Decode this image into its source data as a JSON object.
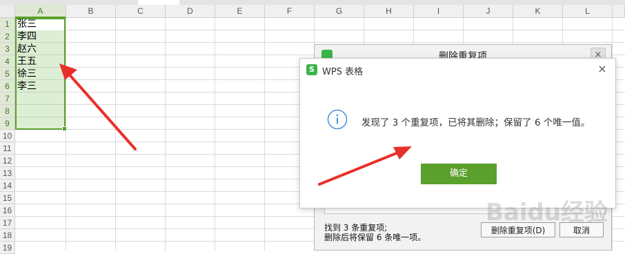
{
  "columns": [
    "A",
    "B",
    "C",
    "D",
    "E",
    "F",
    "G",
    "H",
    "I",
    "J",
    "K",
    "L"
  ],
  "rows": [
    "1",
    "2",
    "3",
    "4",
    "5",
    "6",
    "7",
    "8",
    "9",
    "10",
    "11",
    "12",
    "13",
    "14",
    "15",
    "16",
    "17",
    "18",
    "19"
  ],
  "cells": [
    "张三",
    "李四",
    "赵六",
    "王五",
    "徐三",
    "李三"
  ],
  "background_dialog": {
    "title": "删除重复项",
    "close": "×",
    "found_text": "找到 3 条重复项;",
    "keep_text": "删除后将保留 6 条唯一项。",
    "delete_button": "删除重复项(D)",
    "cancel_button": "取消"
  },
  "dialog": {
    "logo": "S",
    "title": "WPS 表格",
    "close": "×",
    "message": "发现了 3 个重复项，已将其删除；保留了 6 个唯一值。",
    "ok_button": "确定"
  },
  "watermark": "Baidu经验",
  "colors": {
    "accent": "#5aa02c",
    "arrow": "#e8302a",
    "info": "#4a90d9",
    "logo": "#3bb54a"
  }
}
